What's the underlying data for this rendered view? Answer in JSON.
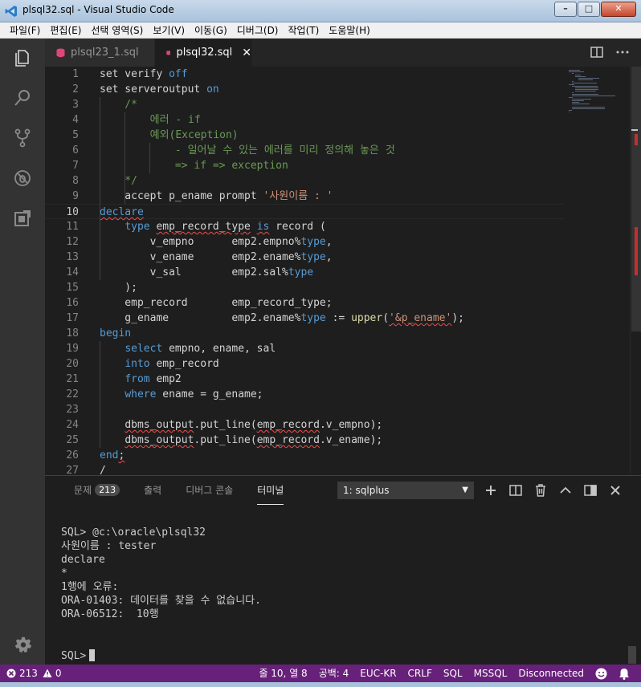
{
  "window": {
    "title": "plsql32.sql - Visual Studio Code",
    "controls": [
      "–",
      "□",
      "✕"
    ]
  },
  "menu": [
    "파일(F)",
    "편집(E)",
    "선택 영역(S)",
    "보기(V)",
    "이동(G)",
    "디버그(D)",
    "작업(T)",
    "도움말(H)"
  ],
  "tabs": [
    {
      "label": "plsql23_1.sql",
      "active": false
    },
    {
      "label": "plsql32.sql",
      "active": true,
      "close": "✕"
    }
  ],
  "tab_actions": [
    "split-editor-icon",
    "more-actions-icon"
  ],
  "editor": {
    "current_line": 10,
    "lines": [
      {
        "n": "1",
        "segs": [
          {
            "t": "set verify ",
            "c": "plain"
          },
          {
            "t": "off",
            "c": "kw"
          }
        ]
      },
      {
        "n": "2",
        "segs": [
          {
            "t": "set serveroutput ",
            "c": "plain"
          },
          {
            "t": "on",
            "c": "kw"
          }
        ]
      },
      {
        "n": "3",
        "segs": [
          {
            "t": "    /*",
            "c": "cmt"
          }
        ]
      },
      {
        "n": "4",
        "segs": [
          {
            "t": "        에러 - if",
            "c": "cmt"
          }
        ]
      },
      {
        "n": "5",
        "segs": [
          {
            "t": "        예외(Exception)",
            "c": "cmt"
          }
        ]
      },
      {
        "n": "6",
        "segs": [
          {
            "t": "            - 일어날 수 있는 에러를 미리 정의해 놓은 것",
            "c": "cmt"
          }
        ]
      },
      {
        "n": "7",
        "segs": [
          {
            "t": "            => if => exception",
            "c": "cmt"
          }
        ]
      },
      {
        "n": "8",
        "segs": [
          {
            "t": "    */",
            "c": "cmt"
          }
        ]
      },
      {
        "n": "9",
        "segs": [
          {
            "t": "    accept p_ename prompt ",
            "c": "plain"
          },
          {
            "t": "'사원이름 : '",
            "c": "str"
          }
        ]
      },
      {
        "n": "10",
        "segs": [
          {
            "t": "declare",
            "c": "kw sq"
          }
        ]
      },
      {
        "n": "11",
        "segs": [
          {
            "t": "    ",
            "c": "plain"
          },
          {
            "t": "type",
            "c": "kw"
          },
          {
            "t": " ",
            "c": "plain"
          },
          {
            "t": "emp_record_type",
            "c": "plain sq"
          },
          {
            "t": " ",
            "c": "plain"
          },
          {
            "t": "is",
            "c": "kw sq"
          },
          {
            "t": " record (",
            "c": "plain"
          }
        ]
      },
      {
        "n": "12",
        "segs": [
          {
            "t": "        v_empno      emp2.empno%",
            "c": "plain"
          },
          {
            "t": "type",
            "c": "kw"
          },
          {
            "t": ",",
            "c": "plain"
          }
        ]
      },
      {
        "n": "13",
        "segs": [
          {
            "t": "        v_ename      emp2.ename%",
            "c": "plain"
          },
          {
            "t": "type",
            "c": "kw"
          },
          {
            "t": ",",
            "c": "plain"
          }
        ]
      },
      {
        "n": "14",
        "segs": [
          {
            "t": "        v_sal        emp2.sal%",
            "c": "plain"
          },
          {
            "t": "type",
            "c": "kw"
          }
        ]
      },
      {
        "n": "15",
        "segs": [
          {
            "t": "    );",
            "c": "plain"
          }
        ]
      },
      {
        "n": "16",
        "segs": [
          {
            "t": "    emp_record       emp_record_type;",
            "c": "plain"
          }
        ]
      },
      {
        "n": "17",
        "segs": [
          {
            "t": "    g_ename          emp2.ename%",
            "c": "plain"
          },
          {
            "t": "type",
            "c": "kw"
          },
          {
            "t": " := ",
            "c": "plain"
          },
          {
            "t": "upper",
            "c": "fn"
          },
          {
            "t": "(",
            "c": "plain"
          },
          {
            "t": "'&p_ename'",
            "c": "str sq"
          },
          {
            "t": ");",
            "c": "plain"
          }
        ]
      },
      {
        "n": "18",
        "segs": [
          {
            "t": "begin",
            "c": "kw"
          }
        ]
      },
      {
        "n": "19",
        "segs": [
          {
            "t": "    ",
            "c": "plain"
          },
          {
            "t": "select",
            "c": "kw"
          },
          {
            "t": " empno, ename, sal",
            "c": "plain"
          }
        ]
      },
      {
        "n": "20",
        "segs": [
          {
            "t": "    ",
            "c": "plain"
          },
          {
            "t": "into",
            "c": "kw"
          },
          {
            "t": " emp_record",
            "c": "plain"
          }
        ]
      },
      {
        "n": "21",
        "segs": [
          {
            "t": "    ",
            "c": "plain"
          },
          {
            "t": "from",
            "c": "kw"
          },
          {
            "t": " emp2",
            "c": "plain"
          }
        ]
      },
      {
        "n": "22",
        "segs": [
          {
            "t": "    ",
            "c": "plain"
          },
          {
            "t": "where",
            "c": "kw"
          },
          {
            "t": " ename = g_ename;",
            "c": "plain"
          }
        ]
      },
      {
        "n": "23",
        "segs": [
          {
            "t": "",
            "c": "plain"
          }
        ]
      },
      {
        "n": "24",
        "segs": [
          {
            "t": "    ",
            "c": "plain"
          },
          {
            "t": "dbms_output",
            "c": "plain sq"
          },
          {
            "t": ".put_line(",
            "c": "plain"
          },
          {
            "t": "emp_record",
            "c": "plain sq"
          },
          {
            "t": ".v_empno);",
            "c": "plain"
          }
        ]
      },
      {
        "n": "25",
        "segs": [
          {
            "t": "    ",
            "c": "plain"
          },
          {
            "t": "dbms_output",
            "c": "plain sq"
          },
          {
            "t": ".put_line(",
            "c": "plain"
          },
          {
            "t": "emp_record",
            "c": "plain sq"
          },
          {
            "t": ".v_ename);",
            "c": "plain"
          }
        ]
      },
      {
        "n": "26",
        "segs": [
          {
            "t": "end",
            "c": "kw"
          },
          {
            "t": ";",
            "c": "plain sq"
          }
        ]
      },
      {
        "n": "27",
        "segs": [
          {
            "t": "/",
            "c": "plain"
          }
        ]
      }
    ]
  },
  "panel": {
    "tabs": [
      {
        "label": "문제",
        "badge": "213"
      },
      {
        "label": "출력"
      },
      {
        "label": "디버그 콘솔"
      },
      {
        "label": "터미널",
        "active": true
      }
    ],
    "terminal_select": "1: sqlplus",
    "actions": [
      "+",
      "▥",
      "🗑",
      "⌃",
      "▢",
      "✕"
    ],
    "terminal_lines": [
      "SQL> @c:\\oracle\\plsql32",
      "사원이름 : tester",
      "declare",
      "*",
      "1행에 오류:",
      "ORA-01403: 데이터를 찾을 수 없습니다.",
      "ORA-06512:  10행"
    ],
    "prompt": "SQL>"
  },
  "status": {
    "errors": "213",
    "warnings": "0",
    "right": [
      "줄 10, 열 8",
      "공백: 4",
      "EUC-KR",
      "CRLF",
      "SQL",
      "MSSQL",
      "Disconnected"
    ]
  },
  "colors": {
    "statusbar": "#68217a",
    "keyword": "#569cd6",
    "string": "#ce9178",
    "comment": "#6a9955"
  }
}
